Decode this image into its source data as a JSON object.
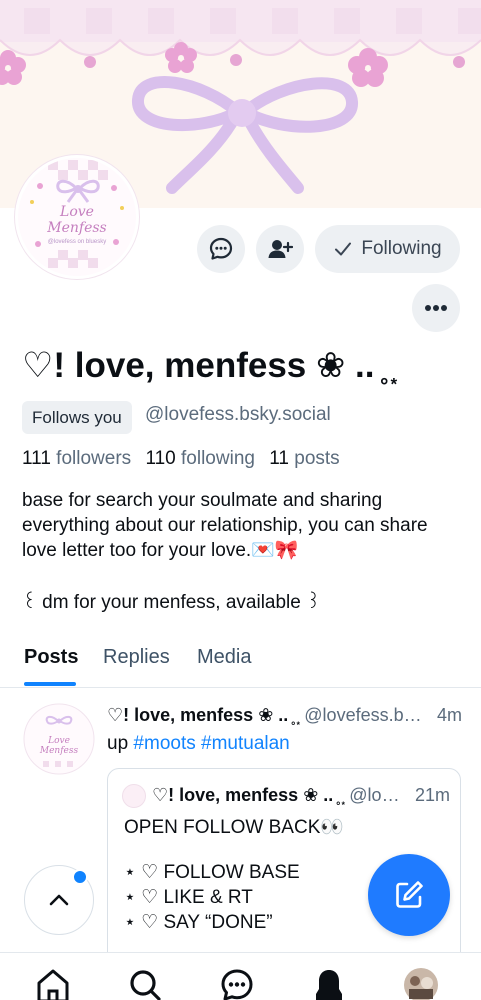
{
  "profile": {
    "display_name": "♡! love, menfess ❀ .. ̥ ͙",
    "follows_you_label": "Follows you",
    "handle": "@lovefess.bsky.social",
    "avatar_text": "Love Menfess",
    "avatar_subtext": "@lovefess on bluesky",
    "stats": {
      "followers_count": "111",
      "followers_label": "followers",
      "following_count": "110",
      "following_label": "following",
      "posts_count": "11",
      "posts_label": "posts"
    },
    "bio": "base for search your soulmate and sharing everything about our relationship, you can share love letter too for your love.💌🎀",
    "bio_line2": "꒰ dm for your menfess, available ꒱"
  },
  "actions": {
    "following_label": "Following"
  },
  "tabs": [
    "Posts",
    "Replies",
    "Media"
  ],
  "post": {
    "author": "♡! love, menfess ❀ .. ̥ ͙",
    "handle": "@lovefess.bsky.social",
    "time": "4m",
    "text_prefix": "up ",
    "hashtags": [
      "#moots",
      "#mutualan"
    ],
    "quote": {
      "author": "♡! love, menfess ❀ .. ̥ ͙",
      "handle": "@lovefess.bsky.social",
      "time": "21m",
      "lines": [
        "OPEN FOLLOW BACK👀",
        "",
        "⋆ ♡ FOLLOW BASE",
        "⋆ ♡ LIKE & RT",
        "⋆ ♡ SAY “DONE”"
      ]
    }
  },
  "colors": {
    "accent": "#1083fe",
    "compose": "#1f7bff",
    "pink": "#e9a3d4",
    "lilac": "#d9c0ec"
  },
  "icons": {
    "message": "message-icon",
    "add_user": "add-user-icon",
    "check": "check-icon",
    "more": "more-icon",
    "compose": "compose-icon",
    "home": "home-icon",
    "search": "search-icon",
    "chat": "chat-icon",
    "notifications": "bell-icon"
  }
}
